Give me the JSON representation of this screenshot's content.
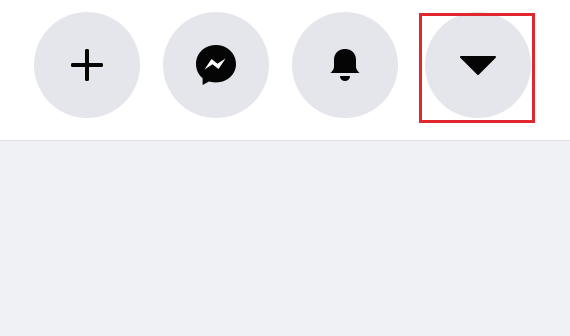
{
  "topbar": {
    "buttons": [
      {
        "name": "create",
        "icon": "plus-icon"
      },
      {
        "name": "messenger",
        "icon": "messenger-icon"
      },
      {
        "name": "notifications",
        "icon": "bell-icon"
      },
      {
        "name": "account",
        "icon": "caret-down-icon"
      }
    ]
  },
  "highlight": {
    "target": "account",
    "color": "#e0262f"
  },
  "colors": {
    "button_bg": "#e4e6eb",
    "icon": "#050505",
    "page_bg": "#f0f1f4",
    "topbar_bg": "#ffffff"
  }
}
